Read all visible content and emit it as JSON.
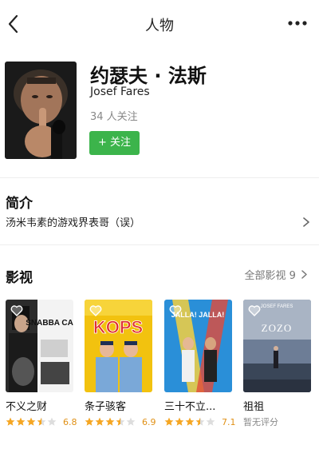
{
  "header": {
    "title": "人物",
    "back_icon": "chevron-left-icon",
    "more_icon": "more-dots-icon"
  },
  "profile": {
    "name_zh": "约瑟夫 · 法斯",
    "name_en": "Josef Fares",
    "followers": "34 人关注",
    "follow_label": "+ 关注",
    "follow_color": "#3cb44b"
  },
  "intro": {
    "title": "简介",
    "text": "汤米韦素的游戏界表哥（误）"
  },
  "works": {
    "title": "影视",
    "all_label": "全部影视 9",
    "items": [
      {
        "title": "不义之财",
        "stars": 3.5,
        "score": "6.8",
        "poster_text": "SNABBA CASH",
        "poster_color": "#2b2b2b"
      },
      {
        "title": "条子骇客",
        "stars": 3.5,
        "score": "6.9",
        "poster_text": "KOPS",
        "poster_color": "#f2c20f"
      },
      {
        "title": "三十不立...",
        "stars": 3.5,
        "score": "7.1",
        "poster_text": "JALLA! JALLA!",
        "poster_color": "#2a8fd8"
      },
      {
        "title": "祖祖",
        "score_text": "暂无评分",
        "poster_text": "ZOZO",
        "poster_top_text": "JOSEF FARES",
        "poster_color": "#6d7d96"
      }
    ]
  },
  "colors": {
    "star": "#f5a623",
    "star_empty": "#dddddd",
    "accent": "#3cb44b"
  }
}
